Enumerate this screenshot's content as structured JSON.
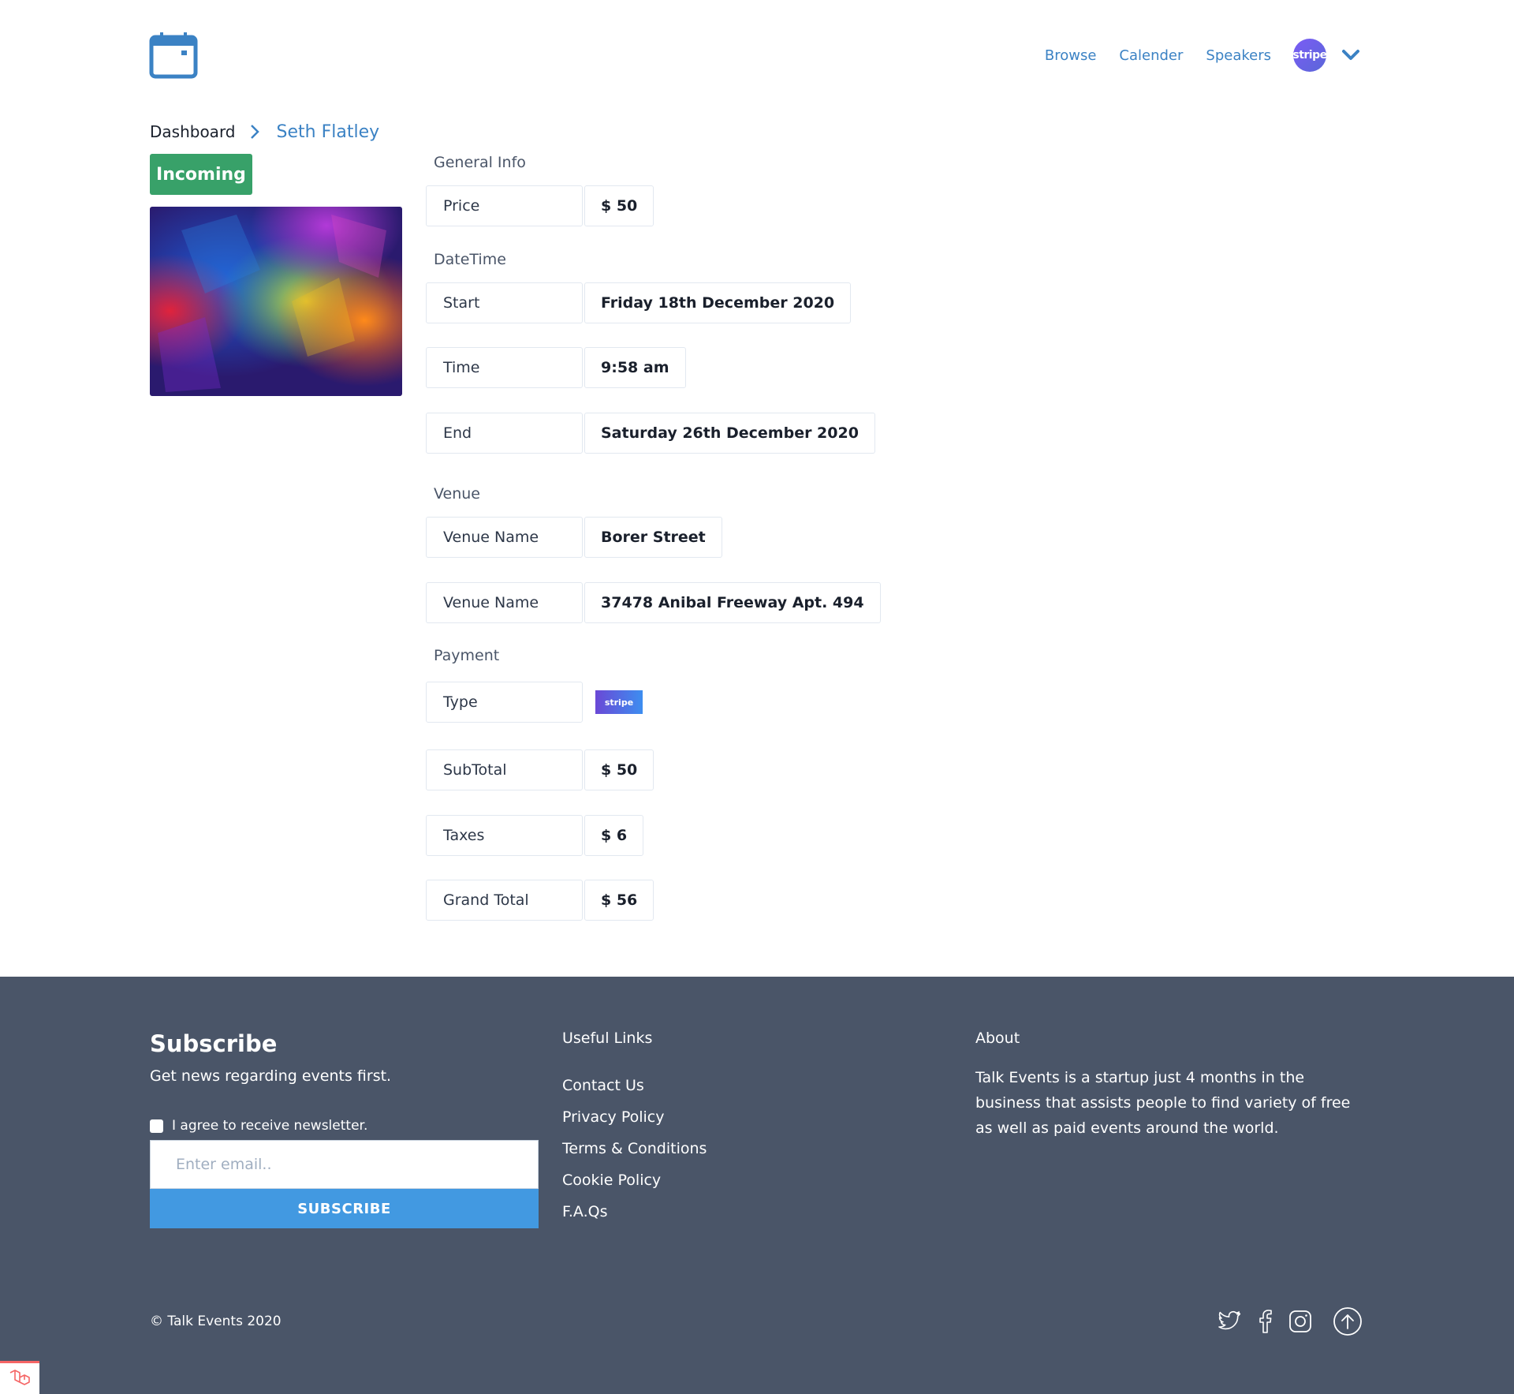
{
  "header": {
    "nav": [
      "Browse",
      "Calender",
      "Speakers"
    ],
    "avatar_text": "stripe"
  },
  "breadcrumb": {
    "home": "Dashboard",
    "current": "Seth Flatley"
  },
  "status": "Incoming",
  "sections": {
    "general": "General Info",
    "datetime": "DateTime",
    "venue": "Venue",
    "payment": "Payment"
  },
  "rows": {
    "price": {
      "label": "Price",
      "value": "$ 50"
    },
    "start": {
      "label": "Start",
      "value": "Friday 18th December 2020"
    },
    "time": {
      "label": "Time",
      "value": "9:58 am"
    },
    "end": {
      "label": "End",
      "value": "Saturday 26th December 2020"
    },
    "venue_name": {
      "label": "Venue Name",
      "value": "Borer Street"
    },
    "venue_address": {
      "label": "Venue Name",
      "value": "37478 Anibal Freeway Apt. 494"
    },
    "type": {
      "label": "Type",
      "value": "stripe"
    },
    "subtotal": {
      "label": "SubTotal",
      "value": "$ 50"
    },
    "taxes": {
      "label": "Taxes",
      "value": "$ 6"
    },
    "grand_total": {
      "label": "Grand Total",
      "value": "$ 56"
    }
  },
  "footer": {
    "subscribe_title": "Subscribe",
    "subscribe_text": "Get news regarding events first.",
    "agree_label": "I agree to receive newsletter.",
    "email_placeholder": "Enter email..",
    "subscribe_button": "SUBSCRIBE",
    "links_title": "Useful Links",
    "links": [
      "Contact Us",
      "Privacy Policy",
      "Terms & Conditions",
      "Cookie Policy",
      "F.A.Qs"
    ],
    "about_title": "About",
    "about_text": "Talk Events is a startup just 4 months in the business that assists people to find variety of free as well as paid events around the world.",
    "copyright": "© Talk Events 2020",
    "socials": [
      "twitter-icon",
      "facebook-icon",
      "instagram-icon",
      "arrow-up-icon"
    ]
  },
  "colors": {
    "accent": "#3b82c4",
    "status": "#38a169",
    "footer_bg": "#4a5568",
    "button": "#4299e1"
  }
}
